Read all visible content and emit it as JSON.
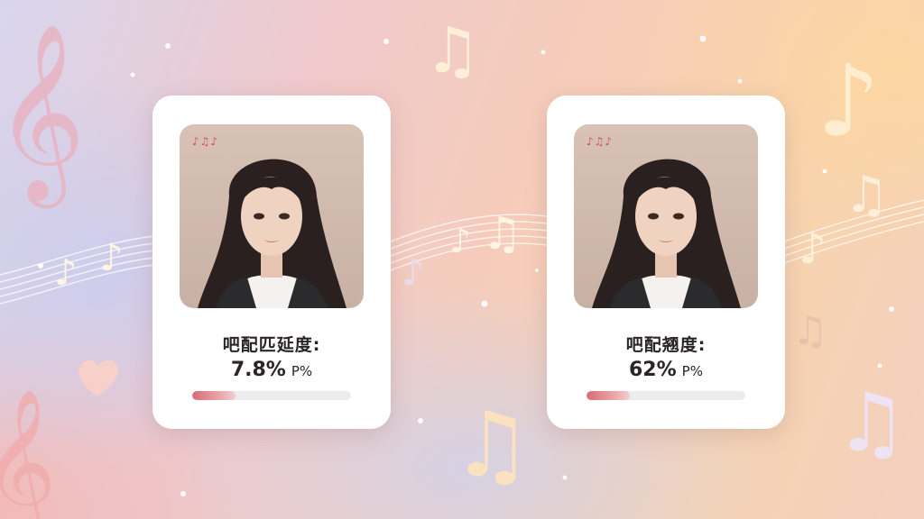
{
  "cards": [
    {
      "logo": "♪♫♪",
      "label": "吧配匹延度:",
      "value": "7.8%",
      "unit": "P%",
      "bar_fraction": 0.27
    },
    {
      "logo": "♪♫♪",
      "label": "吧配翘度:",
      "value": "62%",
      "unit": "P%",
      "bar_fraction": 0.27
    }
  ],
  "colors": {
    "accent": "#d66c76",
    "card": "#ffffff",
    "text": "#2b2426"
  },
  "icons": [
    "treble-clef-icon",
    "music-note-icon",
    "beamed-notes-icon",
    "heart-icon",
    "sparkle-icon",
    "staff-lines-icon"
  ]
}
